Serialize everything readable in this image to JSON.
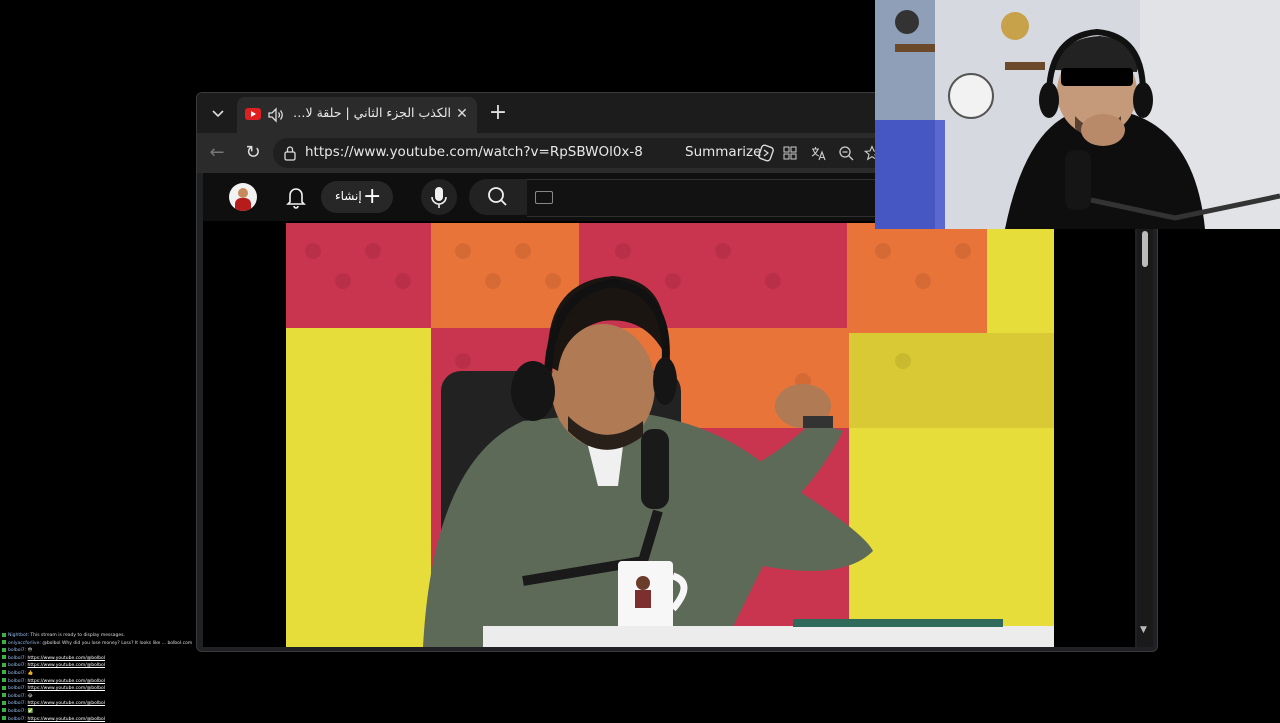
{
  "browser": {
    "tab": {
      "title": "الكذب الجزء الثاني | حلقة لايف مـ",
      "close": "✕",
      "new_tab": "+"
    },
    "toolbar": {
      "back": "←",
      "reload": "↻",
      "url": "https://www.youtube.com/watch?v=RpSBWOl0x-8",
      "summarize_label": "Summarize"
    }
  },
  "youtube": {
    "create_label": "إنشاء",
    "create_plus": "+"
  },
  "chat": {
    "lines": [
      {
        "user": "Nightbot:",
        "text": "This stream is ready to display messages."
      },
      {
        "user": "onlyaccforlive:",
        "text": "@bolbol Why did you lose money? Loss? It looks like ... bolbol.com"
      },
      {
        "user": "bolbol7:",
        "text": "😳"
      },
      {
        "user": "bolbol7:",
        "text": "https://www.youtube.com/@bolbol"
      },
      {
        "user": "bolbol7:",
        "text": "https://www.youtube.com/@bolbol"
      },
      {
        "user": "bolbol7:",
        "text": "👍"
      },
      {
        "user": "bolbol7:",
        "text": "https://www.youtube.com/@bolbol"
      },
      {
        "user": "bolbol7:",
        "text": "https://www.youtube.com/@bolbol"
      },
      {
        "user": "bolbol7:",
        "text": "😂"
      },
      {
        "user": "bolbol7:",
        "text": "https://www.youtube.com/@bolbol"
      },
      {
        "user": "bolbol7:",
        "text": "✅"
      },
      {
        "user": "bolbol7:",
        "text": "https://www.youtube.com/@bolbol"
      }
    ]
  },
  "colors": {
    "accent_red": "#e02020",
    "panel_red": "#c8324a",
    "panel_orange": "#e8743a",
    "panel_yellow": "#e6dc3a"
  },
  "icons": [
    "tab-list-icon",
    "audio-icon",
    "close-icon",
    "plus-icon",
    "back-icon",
    "reload-icon",
    "lock-icon",
    "summarize-icon",
    "extensions-icon",
    "translate-icon",
    "zoom-icon",
    "avatar",
    "bell-icon",
    "mic-icon",
    "search-icon",
    "keyboard-icon"
  ]
}
